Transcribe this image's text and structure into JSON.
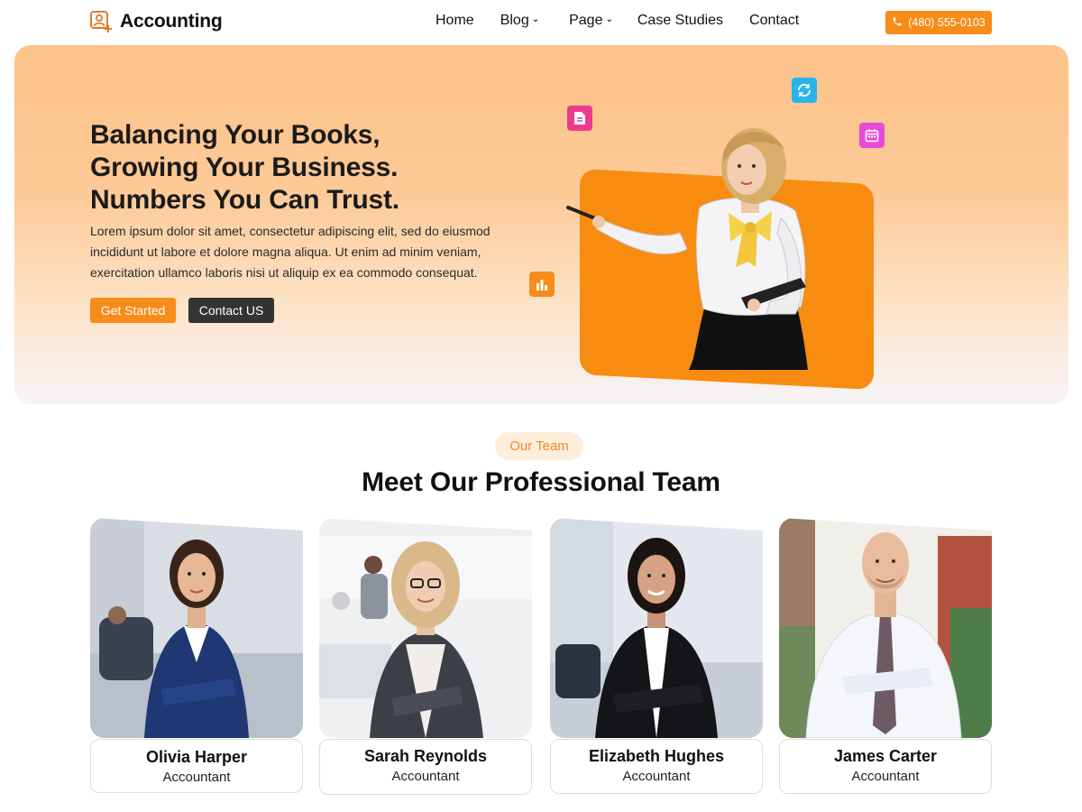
{
  "nav": {
    "brand": "Accounting",
    "items": [
      {
        "label": "Home",
        "dropdown": false
      },
      {
        "label": "Blog",
        "dropdown": true
      },
      {
        "label": "Page",
        "dropdown": true
      },
      {
        "label": "Case Studies",
        "dropdown": false
      },
      {
        "label": "Contact",
        "dropdown": false
      }
    ],
    "phone": "(480) 555-0103"
  },
  "hero": {
    "title_lines": [
      "Balancing Your Books,",
      "Growing Your Business.",
      "Numbers You Can Trust."
    ],
    "description": "Lorem ipsum dolor sit amet, consectetur adipiscing elit, sed do eiusmod incididunt ut labore et dolore magna aliqua. Ut enim ad minim veniam, exercitation ullamco laboris nisi ut aliquip ex ea commodo consequat.",
    "primary_button": "Get Started",
    "secondary_button": "Contact US"
  },
  "team": {
    "pill": "Our Team",
    "title": "Meet Our Professional Team",
    "members": [
      {
        "name": "Olivia Harper",
        "role": "Accountant"
      },
      {
        "name": "Sarah Reynolds",
        "role": "Accountant"
      },
      {
        "name": "Elizabeth Hughes",
        "role": "Accountant"
      },
      {
        "name": "James Carter",
        "role": "Accountant"
      }
    ]
  },
  "colors": {
    "accent": "#f78c1a",
    "dark_button": "#333333",
    "hero_gradient_top": "#fcc38a",
    "pill_bg": "#fdeedc",
    "doc_icon": "#ee3a8c",
    "sync_icon": "#27b5ea",
    "calendar_icon": "#e64ad8"
  },
  "icons": [
    "brand-user-icon",
    "chevron-down-icon",
    "phone-icon",
    "document-icon",
    "sync-icon",
    "calendar-icon",
    "bar-chart-icon"
  ]
}
